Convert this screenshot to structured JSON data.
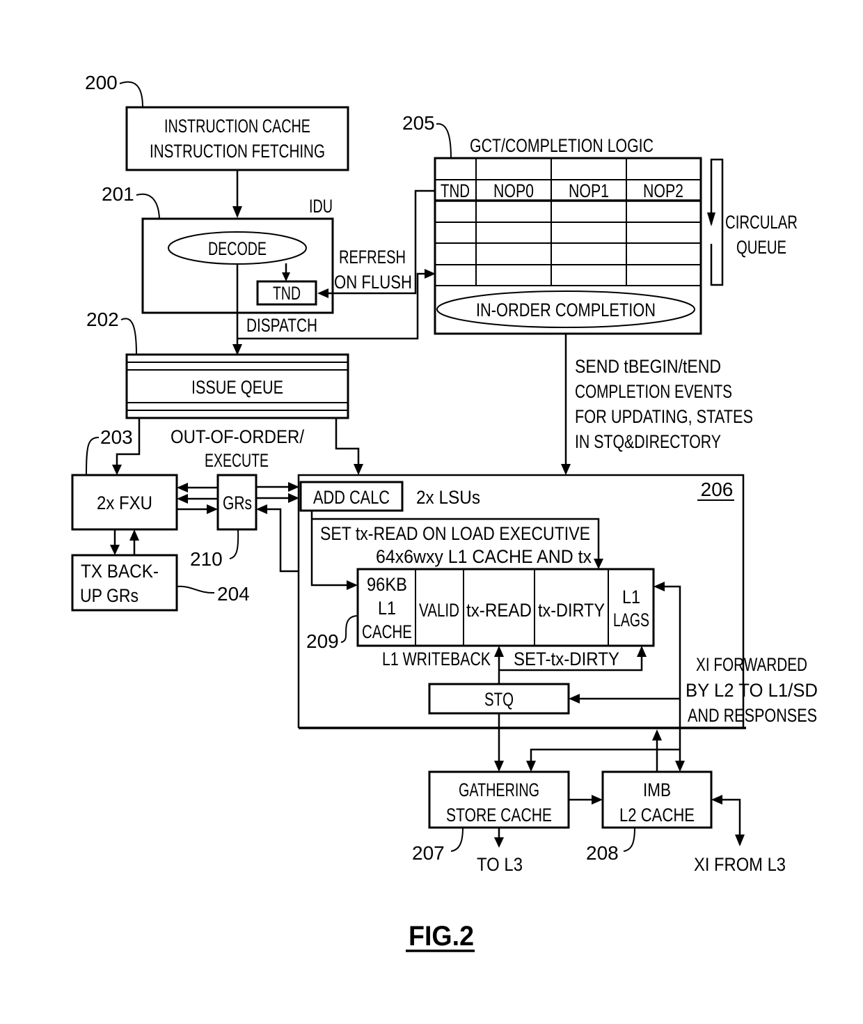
{
  "figure": {
    "label": "FIG.2",
    "accent_color": "#000000",
    "background_color": "#ffffff"
  },
  "refs": {
    "r200": "200",
    "r201": "201",
    "r202": "202",
    "r203": "203",
    "r204": "204",
    "r205": "205",
    "r206": "206",
    "r207": "207",
    "r208": "208",
    "r209": "209",
    "r210": "210"
  },
  "blocks": {
    "icache": {
      "line1": "INSTRUCTION CACHE",
      "line2": "INSTRUCTION FETCHING"
    },
    "idu": {
      "title": "IDU",
      "decode": "DECODE",
      "tnd": "TND"
    },
    "issue_queue": {
      "label": "ISSUE QEUE"
    },
    "fxu": {
      "label": "2x FXU"
    },
    "grs": {
      "label": "GRs"
    },
    "tx_backup": {
      "line1": "TX BACK-",
      "line2": "UP GRs"
    },
    "gct": {
      "title": "GCT/COMPLETION LOGIC",
      "columns": [
        "TND",
        "NOP0",
        "NOP1",
        "NOP2"
      ],
      "in_order": "IN-ORDER COMPLETION",
      "circular_line1": "CIRCULAR",
      "circular_line2": "QUEUE"
    },
    "lsu": {
      "add_calc": "ADD CALC",
      "title": "2x LSUs",
      "set_read_note": "SET tx-READ ON LOAD EXECUTIVE",
      "cache_note": "64x6wxy L1 CACHE AND tx",
      "l1_cells": [
        {
          "lines": [
            "96KB",
            "L1",
            "CACHE"
          ]
        },
        {
          "lines": [
            "VALID"
          ]
        },
        {
          "lines": [
            "tx-READ"
          ]
        },
        {
          "lines": [
            "tx-DIRTY"
          ]
        },
        {
          "lines": [
            "L1",
            "LAGS"
          ]
        }
      ],
      "writeback": "L1 WRITEBACK",
      "set_dirty": "SET-tx-DIRTY",
      "stq": "STQ"
    },
    "gsc": {
      "line1": "GATHERING",
      "line2": "STORE CACHE"
    },
    "l2": {
      "line1": "IMB",
      "line2": "L2 CACHE"
    }
  },
  "annotations": {
    "refresh1": "REFRESH",
    "refresh2": "ON FLUSH",
    "dispatch": "DISPATCH",
    "ooo1": "OUT-OF-ORDER/",
    "ooo2": "EXECUTE",
    "send1": "SEND tBEGIN/tEND",
    "send2": "COMPLETION EVENTS",
    "send3": "FOR UPDATING, STATES",
    "send4": "IN STQ&DIRECTORY",
    "xi1": "XI FORWARDED",
    "xi2": "BY L2 TO L1/SD",
    "xi3": "AND RESPONSES",
    "to_l3": "TO L3",
    "xi_from_l3": "XI FROM L3"
  }
}
